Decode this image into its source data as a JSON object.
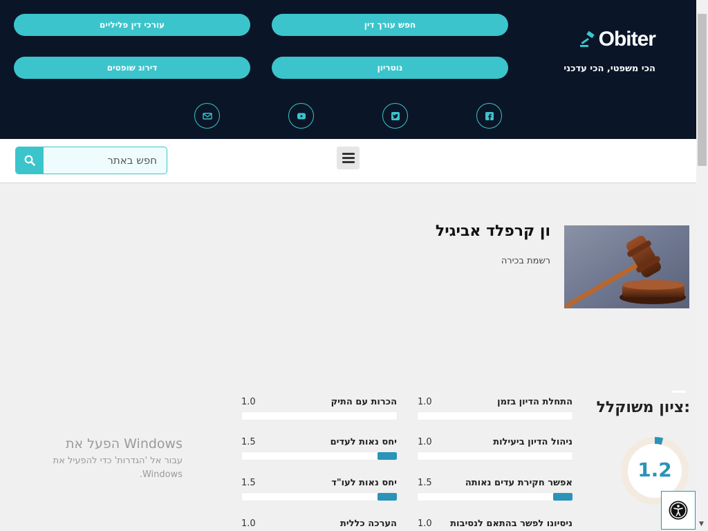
{
  "header": {
    "logo_text": "Obiter",
    "tagline": "הכי משפטי, הכי עדכני",
    "nav_buttons": [
      {
        "label": "חפש עורך דין"
      },
      {
        "label": "עורכי דין פליליים"
      },
      {
        "label": "נוטריון"
      },
      {
        "label": "דירוג שופטים"
      }
    ],
    "social_icons": [
      "facebook-icon",
      "twitter-icon",
      "youtube-icon",
      "email-icon"
    ]
  },
  "search": {
    "placeholder": "חפש באתר"
  },
  "profile": {
    "name": "ון קרפלד אביגיל",
    "subtitle": "רשמת בכירה"
  },
  "ratings": {
    "overall_title": "ציון משוקלל:",
    "overall_value": "1.2",
    "overall_fraction": 0.04,
    "items": [
      {
        "label": "התחלת הדיון בזמן",
        "value": "1.0",
        "fill": 0.0
      },
      {
        "label": "הכרות עם התיק",
        "value": "1.0",
        "fill": 0.0
      },
      {
        "label": "ניהול הדיון ביעילות",
        "value": "1.0",
        "fill": 0.0
      },
      {
        "label": "יחס נאות לעדים",
        "value": "1.5",
        "fill": 0.125
      },
      {
        "label": "אפשר חקירת עדים נאותה",
        "value": "1.5",
        "fill": 0.125
      },
      {
        "label": "יחס נאות לעו\"ד",
        "value": "1.5",
        "fill": 0.125
      },
      {
        "label": "ניסיונו לפשר בהתאם לנסיבות",
        "value": "1.0",
        "fill": 0.0
      },
      {
        "label": "הערכה כללית",
        "value": "1.0",
        "fill": 0.0
      }
    ]
  },
  "watermark": {
    "title": "הפעל את Windows",
    "subtitle": "עבור אל 'הגדרות' כדי להפעיל את Windows."
  },
  "colors": {
    "header_bg": "#0a1628",
    "accent": "#3cc4cc",
    "rating_fill": "#2a93b8"
  }
}
